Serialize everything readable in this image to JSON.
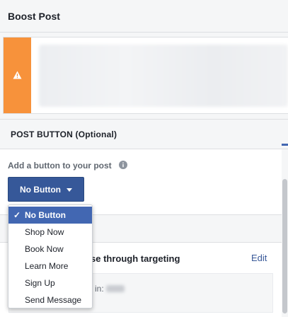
{
  "header": {
    "title": "Boost Post"
  },
  "post_button": {
    "section_title": "POST BUTTON (Optional)",
    "add_label": "Add a button to your post",
    "button_label": "No Button",
    "dropdown": {
      "options": [
        "No Button",
        "Shop Now",
        "Book Now",
        "Learn More",
        "Sign Up",
        "Send Message"
      ],
      "selected": "No Button"
    }
  },
  "audience": {
    "title_partial": "se through targeting",
    "edit_label": "Edit",
    "sub_text_partial": "in:"
  },
  "colors": {
    "accent": "#4267b2",
    "warning": "#f7923b",
    "button": "#365899"
  }
}
